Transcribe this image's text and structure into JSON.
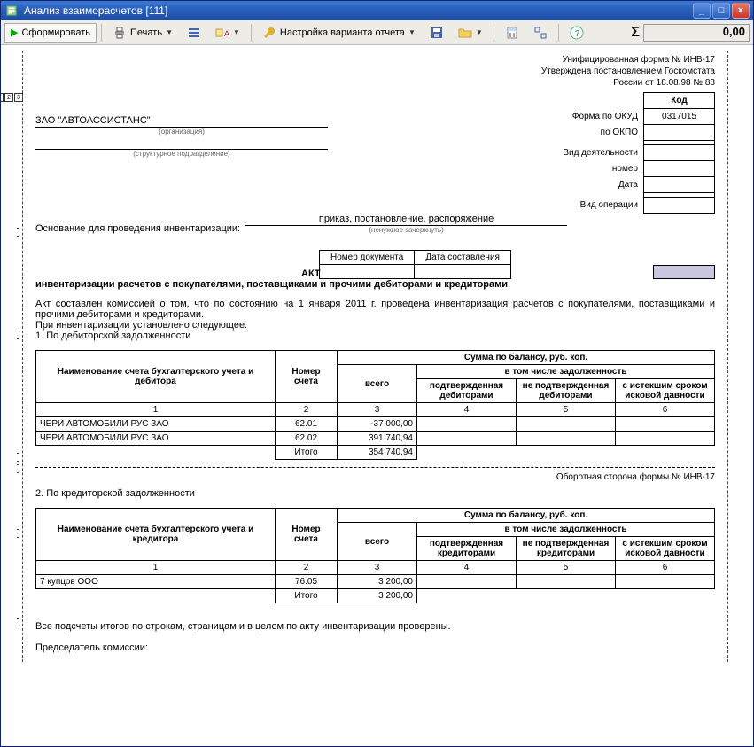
{
  "window": {
    "title": "Анализ взаиморасчетов [111]"
  },
  "toolbar": {
    "form": "Сформировать",
    "print": "Печать",
    "settings": "Настройка варианта отчета",
    "sigma": "Σ",
    "sigma_value": "0,00"
  },
  "uniform": {
    "line1": "Унифицированная форма № ИНВ-17",
    "line2": "Утверждена постановлением Госкомстата",
    "line3": "России от 18.08.98 № 88"
  },
  "codes": {
    "hdr": "Код",
    "okud_lbl": "Форма по ОКУД",
    "okud": "0317015",
    "okpo_lbl": "по ОКПО",
    "act_lbl": "Вид деятельности",
    "num_lbl": "номер",
    "date_lbl": "Дата",
    "oper_lbl": "Вид операции"
  },
  "org": "ЗАО \"АВТОАССИСТАНС\"",
  "org_sub": "(организация)",
  "struct_sub": "(структурное подразделение)",
  "basis_lbl": "Основание для проведения инвентаризации:",
  "basis_val": "приказ, постановление, распоряжение",
  "basis_sub": "(ненужное зачеркнуть)",
  "doc_num": "Номер документа",
  "doc_date": "Дата составления",
  "act": "АКТ",
  "act_title": "инвентаризации расчетов с покупателями, поставщиками и прочими дебиторами и кредиторами",
  "para1": "Акт составлен комиссией о том, что по состоянию на 1 января 2011 г. проведена инвентаризация расчетов с покупателями, поставщиками и прочими дебиторами и кредиторами.",
  "para2": "При инвентаризации установлено следующее:",
  "para3": "1. По дебиторской задолженности",
  "th": {
    "name1": "Наименование счета бухгалтерского учета и дебитора",
    "name2": "Наименование счета бухгалтерского учета и кредитора",
    "acc": "Номер счета",
    "sum": "Сумма по балансу, руб. коп.",
    "total": "всего",
    "incl": "в том числе задолженность",
    "conf1": "подтвержденная дебиторами",
    "nconf1": "не подтвержденная дебиторами",
    "conf2": "подтвержденная кредиторами",
    "nconf2": "не подтвержденная кредиторами",
    "expired": "с истекшим сроком исковой давности",
    "c1": "1",
    "c2": "2",
    "c3": "3",
    "c4": "4",
    "c5": "5",
    "c6": "6",
    "itogo": "Итого"
  },
  "table1": [
    {
      "name": "ЧЕРИ АВТОМОБИЛИ РУС ЗАО",
      "acc": "62.01",
      "total": "-37 000,00"
    },
    {
      "name": "ЧЕРИ АВТОМОБИЛИ РУС ЗАО",
      "acc": "62.02",
      "total": "391 740,94"
    }
  ],
  "table1_total": "354 740,94",
  "reverse": "Оборотная сторона формы № ИНВ-17",
  "section2": "2. По кредиторской задолженности",
  "table2": [
    {
      "name": "7 купцов ООО",
      "acc": "76.05",
      "total": "3 200,00"
    }
  ],
  "table2_total": "3 200,00",
  "tail1": "Все подсчеты итогов по строкам, страницам и в целом по акту инвентаризации проверены.",
  "tail2": "Председатель комиссии:",
  "outline": {
    "b1": "1",
    "b2": "2",
    "b3": "3"
  }
}
